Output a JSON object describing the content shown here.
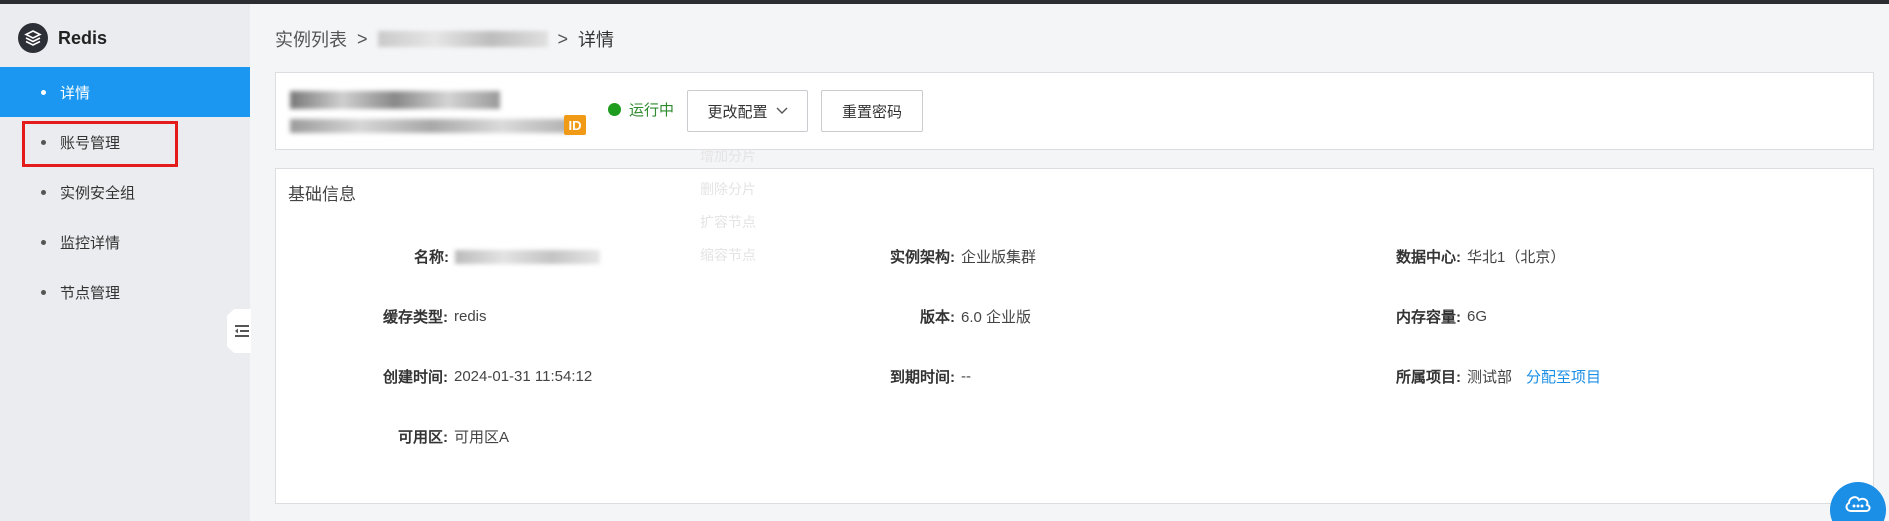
{
  "app": {
    "name": "Redis"
  },
  "sidebar": {
    "items": [
      {
        "label": "详情",
        "active": true
      },
      {
        "label": "账号管理",
        "active": false
      },
      {
        "label": "实例安全组",
        "active": false
      },
      {
        "label": "监控详情",
        "active": false
      },
      {
        "label": "节点管理",
        "active": false
      }
    ]
  },
  "breadcrumb": {
    "root": "实例列表",
    "sep": ">",
    "current": "详情"
  },
  "instance": {
    "id_badge": "ID",
    "status": "运行中",
    "config_button": "更改配置",
    "reset_password_button": "重置密码"
  },
  "faded_menu": [
    "增加分片",
    "删除分片",
    "扩容节点",
    "缩容节点"
  ],
  "basic_info": {
    "title": "基础信息",
    "fields": {
      "name": {
        "label": "名称:"
      },
      "arch": {
        "label": "实例架构:",
        "value": "企业版集群"
      },
      "dc": {
        "label": "数据中心:",
        "value": "华北1（北京）"
      },
      "cache_type": {
        "label": "缓存类型:",
        "value": "redis"
      },
      "version": {
        "label": "版本:",
        "value": "6.0 企业版"
      },
      "memory": {
        "label": "内存容量:",
        "value": "6G"
      },
      "created": {
        "label": "创建时间:",
        "value": "2024-01-31 11:54:12"
      },
      "expire": {
        "label": "到期时间:",
        "value": "--"
      },
      "project": {
        "label": "所属项目:",
        "value": "测试部",
        "link": "分配至项目"
      },
      "zone": {
        "label": "可用区:",
        "value": "可用区A"
      }
    }
  },
  "colors": {
    "accent": "#1b97f1",
    "status_green": "#1e9c1e",
    "highlight_red": "#e31b1b",
    "badge_orange": "#f09a16",
    "link_blue": "#1b8ee6"
  }
}
